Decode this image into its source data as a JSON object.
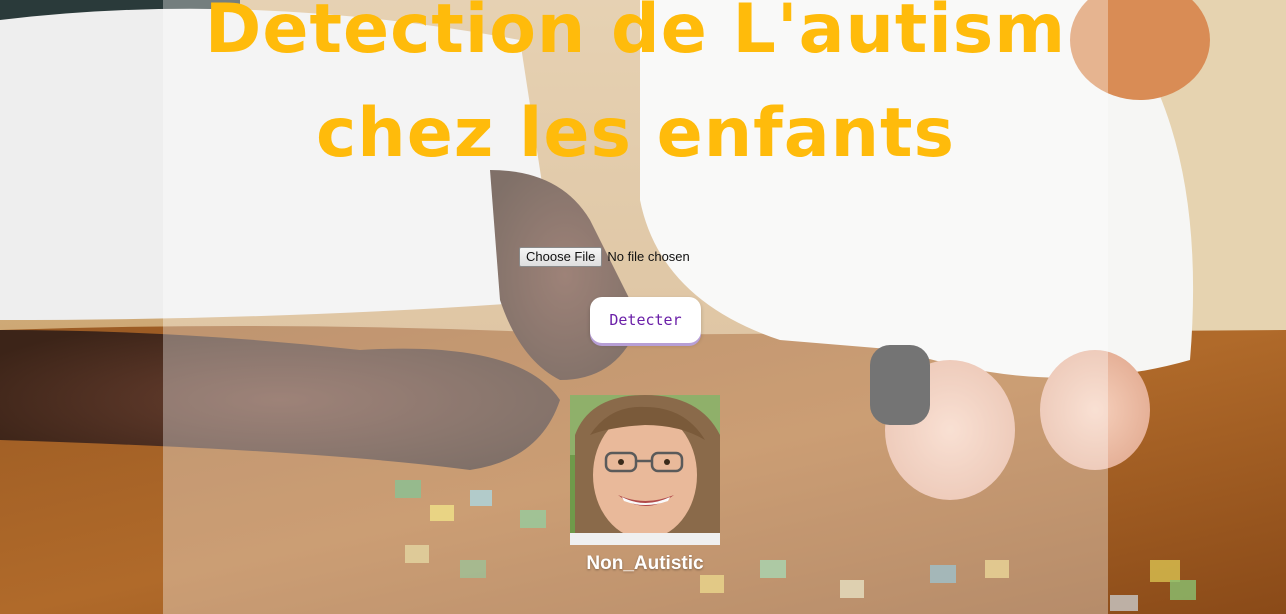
{
  "page": {
    "title": "Detection de L'autism chez les enfants",
    "title_color": "#ffbb0b"
  },
  "upload": {
    "button_label": "Choose File",
    "status_text": "No file chosen"
  },
  "detect_button": {
    "label": "Detecter",
    "text_color": "#6a1fa8"
  },
  "result": {
    "label": "Non_Autistic",
    "photo_icon": "child-portrait-photo"
  },
  "background": {
    "image": "children-playing-puzzle-photo"
  }
}
